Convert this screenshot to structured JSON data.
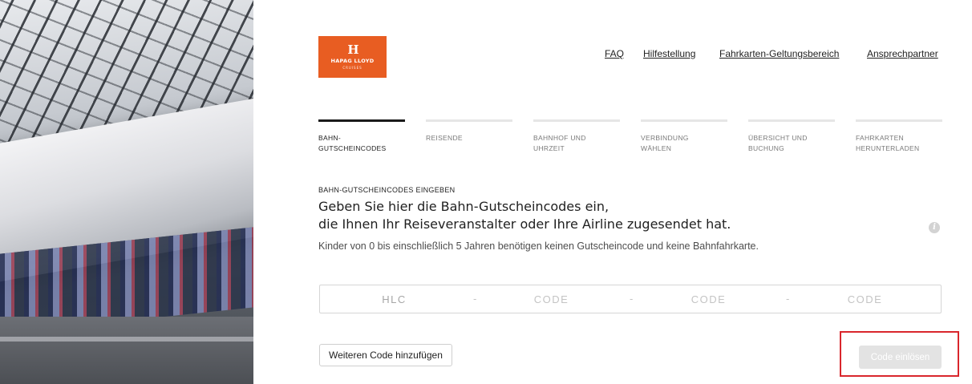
{
  "brand": {
    "logo_mark": "H",
    "logo_name": "HAPAG LLOYD",
    "logo_sub": "CRUISES",
    "color": "#e85d22"
  },
  "nav": {
    "links": [
      "FAQ",
      "Hilfestellung",
      "Fahrkarten-Geltungsbereich",
      "Ansprechpartner"
    ]
  },
  "steps": [
    {
      "label": "BAHN-\nGUTSCHEINCODES",
      "active": true
    },
    {
      "label": "REISENDE",
      "active": false
    },
    {
      "label": "BAHNHOF UND\nUHRZEIT",
      "active": false
    },
    {
      "label": "VERBINDUNG\nWÄHLEN",
      "active": false
    },
    {
      "label": "ÜBERSICHT UND\nBUCHUNG",
      "active": false
    },
    {
      "label": "FAHRKARTEN\nHERUNTERLADEN",
      "active": false
    }
  ],
  "form": {
    "kicker": "BAHN-GUTSCHEINCODES EINGEBEN",
    "headline_1": "Geben Sie hier die Bahn-Gutscheincodes ein,",
    "headline_2": "die Ihnen Ihr Reiseveranstalter oder Ihre Airline zugesendet hat.",
    "hint": "Kinder von 0 bis einschließlich 5 Jahren benötigen keinen Gutscheincode und keine Bahnfahrkarte.",
    "info_icon": "info-icon",
    "code_prefix": "HLC",
    "code_placeholder": "CODE",
    "separator": "-",
    "add_button": "Weiteren Code hinzufügen",
    "redeem_button": "Code einlösen",
    "highlight_color": "#d9262c"
  }
}
